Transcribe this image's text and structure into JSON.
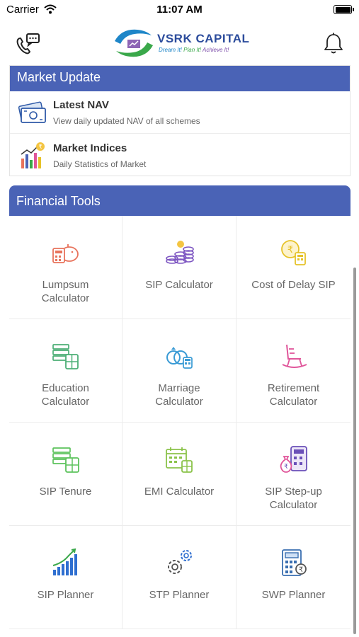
{
  "status_bar": {
    "carrier": "Carrier",
    "time": "11:07 AM"
  },
  "header": {
    "brand": "VSRK CAPITAL",
    "tagline": {
      "part1": "Dream It!",
      "part2": "Plan It!",
      "part3": "Achieve It!"
    },
    "icons": {
      "left": "phone-chat-icon",
      "right": "bell-icon"
    }
  },
  "market_update": {
    "title": "Market Update",
    "items": [
      {
        "title": "Latest NAV",
        "subtitle": "View daily updated NAV of all schemes",
        "icon": "money-icon"
      },
      {
        "title": "Market Indices",
        "subtitle": "Daily Statistics of Market",
        "icon": "bar-chart-rupee-icon"
      }
    ]
  },
  "financial_tools": {
    "title": "Financial Tools",
    "tools": [
      {
        "line1": "Lumpsum",
        "line2": "Calculator",
        "icon": "piggy-bank-calculator-icon",
        "color": "#e8735c"
      },
      {
        "line1": "SIP Calculator",
        "line2": "",
        "icon": "coins-stack-icon",
        "color": "#7e57c2"
      },
      {
        "line1": "Cost of Delay SIP",
        "line2": "",
        "icon": "rupee-calculator-icon",
        "color": "#e6c229"
      },
      {
        "line1": "Education",
        "line2": "Calculator",
        "icon": "books-calculator-icon",
        "color": "#4caf76"
      },
      {
        "line1": "Marriage",
        "line2": "Calculator",
        "icon": "rings-calculator-icon",
        "color": "#3a9bd5"
      },
      {
        "line1": "Retirement",
        "line2": "Calculator",
        "icon": "rocking-chair-icon",
        "color": "#e0559a"
      },
      {
        "line1": "SIP Tenure",
        "line2": "",
        "icon": "books-calculator-icon",
        "color": "#5cc25c"
      },
      {
        "line1": "EMI Calculator",
        "line2": "",
        "icon": "calendar-calculator-icon",
        "color": "#8bc34a"
      },
      {
        "line1": "SIP Step-up",
        "line2": "Calculator",
        "icon": "moneybag-calculator-icon",
        "color": "#6a4fb8"
      },
      {
        "line1": "SIP Planner",
        "line2": "",
        "icon": "growth-bars-icon",
        "color": "#2f6fd0"
      },
      {
        "line1": "STP Planner",
        "line2": "",
        "icon": "gears-icon",
        "color": "#555555"
      },
      {
        "line1": "SWP Planner",
        "line2": "",
        "icon": "calculator-rupee-icon",
        "color": "#3a6fb0"
      }
    ]
  },
  "colors": {
    "accent": "#4a63b6"
  }
}
